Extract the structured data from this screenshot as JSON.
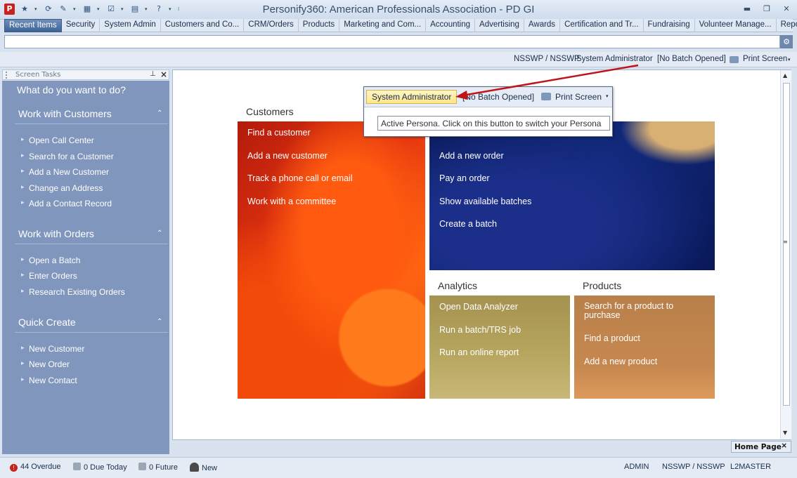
{
  "app": {
    "logo_letter": "P",
    "title": "Personify360: American Professionals Association - PD GI"
  },
  "tabs": [
    {
      "label": "Recent Items"
    },
    {
      "label": "Security"
    },
    {
      "label": "System Admin"
    },
    {
      "label": "Customers and Co..."
    },
    {
      "label": "CRM/Orders"
    },
    {
      "label": "Products"
    },
    {
      "label": "Marketing and Com..."
    },
    {
      "label": "Accounting"
    },
    {
      "label": "Advertising"
    },
    {
      "label": "Awards"
    },
    {
      "label": "Certification and Tr..."
    },
    {
      "label": "Fundraising"
    },
    {
      "label": "Volunteer Manage..."
    },
    {
      "label": "Reporting"
    }
  ],
  "status_strip": {
    "org": "NSSWP / NSSWP",
    "persona": "System Administrator",
    "batch": "[No Batch Opened]",
    "print": "Print Screen"
  },
  "panel": {
    "title": "Screen Tasks",
    "question": "What do you want to do?",
    "sections": [
      {
        "title": "Work with Customers",
        "items": [
          "Open Call Center",
          "Search for a Customer",
          "Add a New Customer",
          "Change an Address",
          "Add a Contact Record"
        ]
      },
      {
        "title": "Work with Orders",
        "items": [
          "Open a Batch",
          "Enter Orders",
          "Research Existing Orders"
        ]
      },
      {
        "title": "Quick Create",
        "items": [
          "New Customer",
          "New Order",
          "New Contact"
        ]
      }
    ]
  },
  "home": {
    "customers": {
      "title": "Customers",
      "links": [
        "Find a customer",
        "Add a new customer",
        "Track a phone call or email",
        "Work with a committee"
      ]
    },
    "orders": {
      "links": [
        "Add a new order",
        "Pay an order",
        "Show available batches",
        "Create a batch"
      ]
    },
    "analytics": {
      "title": "Analytics",
      "links": [
        "Open Data Analyzer",
        "Run a batch/TRS job",
        "Run an online report"
      ]
    },
    "products": {
      "title": "Products",
      "links": [
        "Search for a product to purchase",
        "Find a product",
        "Add a new product"
      ]
    }
  },
  "popup": {
    "persona": "System Administrator",
    "batch": "[No Batch Opened]",
    "print": "Print Screen",
    "tooltip": "Active Persona. Click on this button to switch your Persona"
  },
  "hometab": {
    "label": "Home Page"
  },
  "bottom": {
    "overdue": "44 Overdue",
    "due_today": "0 Due Today",
    "future": "0 Future",
    "new": "New",
    "user": "ADMIN",
    "org": "NSSWP / NSSWP",
    "server": "L2MASTER"
  },
  "colors": {
    "accent": "#c8241f",
    "panel": "#8196bd",
    "arrow": "#c0141b"
  }
}
